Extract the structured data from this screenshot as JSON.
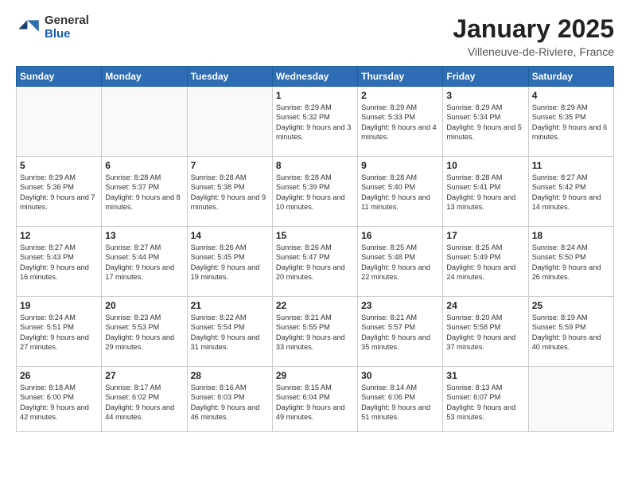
{
  "header": {
    "logo": {
      "general": "General",
      "blue": "Blue"
    },
    "title": "January 2025",
    "location": "Villeneuve-de-Riviere, France"
  },
  "weekdays": [
    "Sunday",
    "Monday",
    "Tuesday",
    "Wednesday",
    "Thursday",
    "Friday",
    "Saturday"
  ],
  "weeks": [
    [
      {
        "day": "",
        "sunrise": "",
        "sunset": "",
        "daylight": ""
      },
      {
        "day": "",
        "sunrise": "",
        "sunset": "",
        "daylight": ""
      },
      {
        "day": "",
        "sunrise": "",
        "sunset": "",
        "daylight": ""
      },
      {
        "day": "1",
        "sunrise": "Sunrise: 8:29 AM",
        "sunset": "Sunset: 5:32 PM",
        "daylight": "Daylight: 9 hours and 3 minutes."
      },
      {
        "day": "2",
        "sunrise": "Sunrise: 8:29 AM",
        "sunset": "Sunset: 5:33 PM",
        "daylight": "Daylight: 9 hours and 4 minutes."
      },
      {
        "day": "3",
        "sunrise": "Sunrise: 8:29 AM",
        "sunset": "Sunset: 5:34 PM",
        "daylight": "Daylight: 9 hours and 5 minutes."
      },
      {
        "day": "4",
        "sunrise": "Sunrise: 8:29 AM",
        "sunset": "Sunset: 5:35 PM",
        "daylight": "Daylight: 9 hours and 6 minutes."
      }
    ],
    [
      {
        "day": "5",
        "sunrise": "Sunrise: 8:29 AM",
        "sunset": "Sunset: 5:36 PM",
        "daylight": "Daylight: 9 hours and 7 minutes."
      },
      {
        "day": "6",
        "sunrise": "Sunrise: 8:28 AM",
        "sunset": "Sunset: 5:37 PM",
        "daylight": "Daylight: 9 hours and 8 minutes."
      },
      {
        "day": "7",
        "sunrise": "Sunrise: 8:28 AM",
        "sunset": "Sunset: 5:38 PM",
        "daylight": "Daylight: 9 hours and 9 minutes."
      },
      {
        "day": "8",
        "sunrise": "Sunrise: 8:28 AM",
        "sunset": "Sunset: 5:39 PM",
        "daylight": "Daylight: 9 hours and 10 minutes."
      },
      {
        "day": "9",
        "sunrise": "Sunrise: 8:28 AM",
        "sunset": "Sunset: 5:40 PM",
        "daylight": "Daylight: 9 hours and 11 minutes."
      },
      {
        "day": "10",
        "sunrise": "Sunrise: 8:28 AM",
        "sunset": "Sunset: 5:41 PM",
        "daylight": "Daylight: 9 hours and 13 minutes."
      },
      {
        "day": "11",
        "sunrise": "Sunrise: 8:27 AM",
        "sunset": "Sunset: 5:42 PM",
        "daylight": "Daylight: 9 hours and 14 minutes."
      }
    ],
    [
      {
        "day": "12",
        "sunrise": "Sunrise: 8:27 AM",
        "sunset": "Sunset: 5:43 PM",
        "daylight": "Daylight: 9 hours and 16 minutes."
      },
      {
        "day": "13",
        "sunrise": "Sunrise: 8:27 AM",
        "sunset": "Sunset: 5:44 PM",
        "daylight": "Daylight: 9 hours and 17 minutes."
      },
      {
        "day": "14",
        "sunrise": "Sunrise: 8:26 AM",
        "sunset": "Sunset: 5:45 PM",
        "daylight": "Daylight: 9 hours and 19 minutes."
      },
      {
        "day": "15",
        "sunrise": "Sunrise: 8:26 AM",
        "sunset": "Sunset: 5:47 PM",
        "daylight": "Daylight: 9 hours and 20 minutes."
      },
      {
        "day": "16",
        "sunrise": "Sunrise: 8:25 AM",
        "sunset": "Sunset: 5:48 PM",
        "daylight": "Daylight: 9 hours and 22 minutes."
      },
      {
        "day": "17",
        "sunrise": "Sunrise: 8:25 AM",
        "sunset": "Sunset: 5:49 PM",
        "daylight": "Daylight: 9 hours and 24 minutes."
      },
      {
        "day": "18",
        "sunrise": "Sunrise: 8:24 AM",
        "sunset": "Sunset: 5:50 PM",
        "daylight": "Daylight: 9 hours and 26 minutes."
      }
    ],
    [
      {
        "day": "19",
        "sunrise": "Sunrise: 8:24 AM",
        "sunset": "Sunset: 5:51 PM",
        "daylight": "Daylight: 9 hours and 27 minutes."
      },
      {
        "day": "20",
        "sunrise": "Sunrise: 8:23 AM",
        "sunset": "Sunset: 5:53 PM",
        "daylight": "Daylight: 9 hours and 29 minutes."
      },
      {
        "day": "21",
        "sunrise": "Sunrise: 8:22 AM",
        "sunset": "Sunset: 5:54 PM",
        "daylight": "Daylight: 9 hours and 31 minutes."
      },
      {
        "day": "22",
        "sunrise": "Sunrise: 8:21 AM",
        "sunset": "Sunset: 5:55 PM",
        "daylight": "Daylight: 9 hours and 33 minutes."
      },
      {
        "day": "23",
        "sunrise": "Sunrise: 8:21 AM",
        "sunset": "Sunset: 5:57 PM",
        "daylight": "Daylight: 9 hours and 35 minutes."
      },
      {
        "day": "24",
        "sunrise": "Sunrise: 8:20 AM",
        "sunset": "Sunset: 5:58 PM",
        "daylight": "Daylight: 9 hours and 37 minutes."
      },
      {
        "day": "25",
        "sunrise": "Sunrise: 8:19 AM",
        "sunset": "Sunset: 5:59 PM",
        "daylight": "Daylight: 9 hours and 40 minutes."
      }
    ],
    [
      {
        "day": "26",
        "sunrise": "Sunrise: 8:18 AM",
        "sunset": "Sunset: 6:00 PM",
        "daylight": "Daylight: 9 hours and 42 minutes."
      },
      {
        "day": "27",
        "sunrise": "Sunrise: 8:17 AM",
        "sunset": "Sunset: 6:02 PM",
        "daylight": "Daylight: 9 hours and 44 minutes."
      },
      {
        "day": "28",
        "sunrise": "Sunrise: 8:16 AM",
        "sunset": "Sunset: 6:03 PM",
        "daylight": "Daylight: 9 hours and 46 minutes."
      },
      {
        "day": "29",
        "sunrise": "Sunrise: 8:15 AM",
        "sunset": "Sunset: 6:04 PM",
        "daylight": "Daylight: 9 hours and 49 minutes."
      },
      {
        "day": "30",
        "sunrise": "Sunrise: 8:14 AM",
        "sunset": "Sunset: 6:06 PM",
        "daylight": "Daylight: 9 hours and 51 minutes."
      },
      {
        "day": "31",
        "sunrise": "Sunrise: 8:13 AM",
        "sunset": "Sunset: 6:07 PM",
        "daylight": "Daylight: 9 hours and 53 minutes."
      },
      {
        "day": "",
        "sunrise": "",
        "sunset": "",
        "daylight": ""
      }
    ]
  ]
}
